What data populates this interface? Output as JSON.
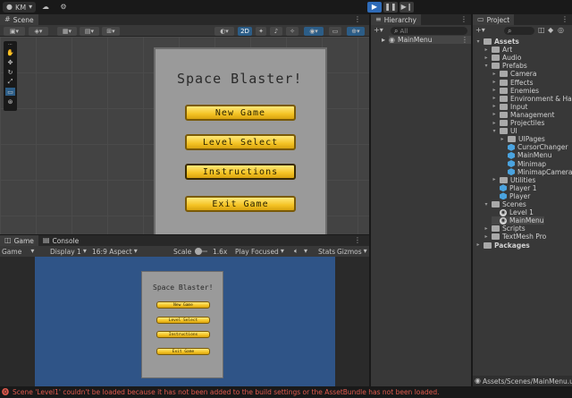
{
  "top_bar": {
    "account": "KM"
  },
  "scene_panel": {
    "tab": "Scene",
    "toolbar": {
      "mode_2d": "2D"
    }
  },
  "menu": {
    "title": "Space Blaster!",
    "buttons": [
      "New Game",
      "Level Select",
      "Instructions",
      "Exit Game"
    ]
  },
  "game_panel": {
    "tabs": [
      "Game",
      "Console"
    ],
    "toolbar": {
      "view_select": "Game",
      "display": "Display 1",
      "aspect": "16:9 Aspect",
      "scale_label": "Scale",
      "scale_value": "1.6x",
      "play_mode": "Play Focused",
      "stats": "Stats",
      "gizmos": "Gizmos"
    }
  },
  "hierarchy": {
    "tab": "Hierarchy",
    "search_placeholder": "All",
    "items": [
      {
        "label": "MainMenu"
      }
    ]
  },
  "project": {
    "tab": "Project",
    "tree": [
      {
        "label": "Assets",
        "level": 0,
        "icon": "folder-open",
        "bold": true
      },
      {
        "label": "Art",
        "level": 1,
        "icon": "folder"
      },
      {
        "label": "Audio",
        "level": 1,
        "icon": "folder"
      },
      {
        "label": "Prefabs",
        "level": 1,
        "icon": "folder-open"
      },
      {
        "label": "Camera",
        "level": 2,
        "icon": "folder"
      },
      {
        "label": "Effects",
        "level": 2,
        "icon": "folder"
      },
      {
        "label": "Enemies",
        "level": 2,
        "icon": "folder"
      },
      {
        "label": "Environment & Haza",
        "level": 2,
        "icon": "folder"
      },
      {
        "label": "Input",
        "level": 2,
        "icon": "folder"
      },
      {
        "label": "Management",
        "level": 2,
        "icon": "folder"
      },
      {
        "label": "Projectiles",
        "level": 2,
        "icon": "folder"
      },
      {
        "label": "UI",
        "level": 2,
        "icon": "folder-open"
      },
      {
        "label": "UIPages",
        "level": 3,
        "icon": "folder"
      },
      {
        "label": "CursorChanger",
        "level": 3,
        "icon": "prefab"
      },
      {
        "label": "MainMenu",
        "level": 3,
        "icon": "prefab"
      },
      {
        "label": "Minimap",
        "level": 3,
        "icon": "prefab"
      },
      {
        "label": "MinimapCamera",
        "level": 3,
        "icon": "prefab"
      },
      {
        "label": "Utilities",
        "level": 2,
        "icon": "folder"
      },
      {
        "label": "Player 1",
        "level": 2,
        "icon": "prefab"
      },
      {
        "label": "Player",
        "level": 2,
        "icon": "prefab"
      },
      {
        "label": "Scenes",
        "level": 1,
        "icon": "folder-open"
      },
      {
        "label": "Level 1",
        "level": 2,
        "icon": "unity-scene"
      },
      {
        "label": "MainMenu",
        "level": 2,
        "icon": "unity-scene"
      },
      {
        "label": "Scripts",
        "level": 1,
        "icon": "folder"
      },
      {
        "label": "TextMesh Pro",
        "level": 1,
        "icon": "folder"
      },
      {
        "label": "Packages",
        "level": 0,
        "icon": "folder",
        "bold": true
      }
    ],
    "path": "Assets/Scenes/MainMenu.u"
  },
  "status_bar": {
    "message": "Scene 'Level1' couldn't be loaded because it has not been added to the build settings or the AssetBundle has not been loaded.",
    "color": "#e05a4d"
  }
}
